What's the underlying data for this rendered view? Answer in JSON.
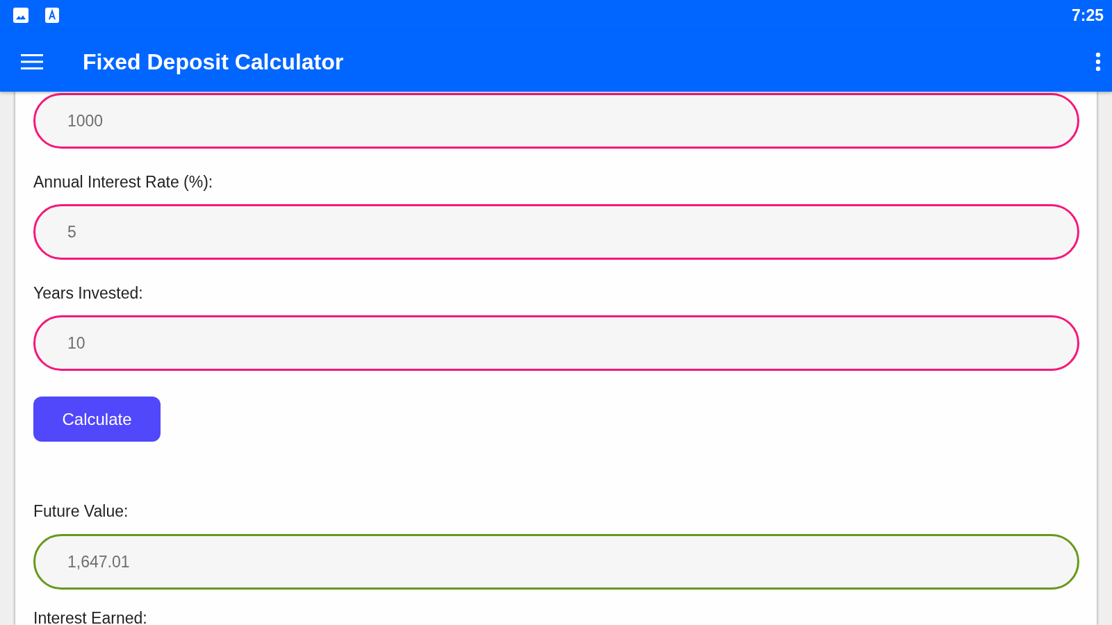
{
  "status_bar": {
    "time": "7:25"
  },
  "app_bar": {
    "title": "Fixed Deposit Calculator"
  },
  "form": [
    {
      "kind": "field",
      "value": "1000",
      "color": "#f5177a"
    },
    {
      "kind": "label",
      "text": "Annual Interest Rate (%):"
    },
    {
      "kind": "field",
      "value": "5",
      "color": "#f5177a"
    },
    {
      "kind": "label",
      "text": "Years Invested:"
    },
    {
      "kind": "field",
      "value": "10",
      "color": "#f5177a"
    },
    {
      "kind": "button",
      "text": "Calculate"
    },
    {
      "kind": "label",
      "text": "Future Value:"
    },
    {
      "kind": "field",
      "value": "1,647.01",
      "color": "#66991a"
    },
    {
      "kind": "label",
      "text": "Interest Earned:"
    }
  ]
}
